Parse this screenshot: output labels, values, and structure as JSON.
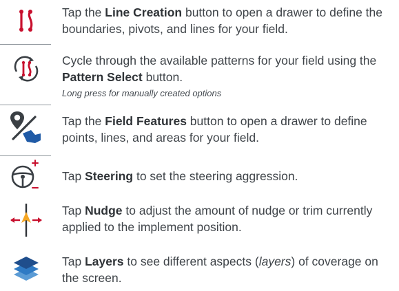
{
  "items": [
    {
      "icon": "line-creation-icon",
      "before": "Tap the ",
      "bold": "Line Creation",
      "after": " button to open a drawer to define the boundaries, pivots, and lines for your field."
    },
    {
      "icon": "pattern-select-icon",
      "before": "Cycle through the available patterns for your field using the ",
      "bold": "Pattern Select",
      "after": " button.",
      "note": "Long press for manually created options"
    },
    {
      "icon": "field-features-icon",
      "before": "Tap the ",
      "bold": "Field Features",
      "after": " button to open a drawer to define points, lines, and areas for your field."
    },
    {
      "icon": "steering-wheel-icon",
      "before": "Tap ",
      "bold": "Steering",
      "after": " to set the steering aggression."
    },
    {
      "icon": "nudge-icon",
      "before": "Tap ",
      "bold": "Nudge",
      "after": " to adjust the amount of nudge or trim currently applied to the implement position."
    },
    {
      "icon": "layers-icon",
      "before": "Tap ",
      "bold": "Layers",
      "after_1": " to see different aspects (",
      "italic": "layers",
      "after": ") of coverage on the screen."
    }
  ],
  "colors": {
    "accent_red": "#c8102e",
    "accent_blue": "#1f5aa6",
    "nudge_orange": "#f5a623"
  }
}
